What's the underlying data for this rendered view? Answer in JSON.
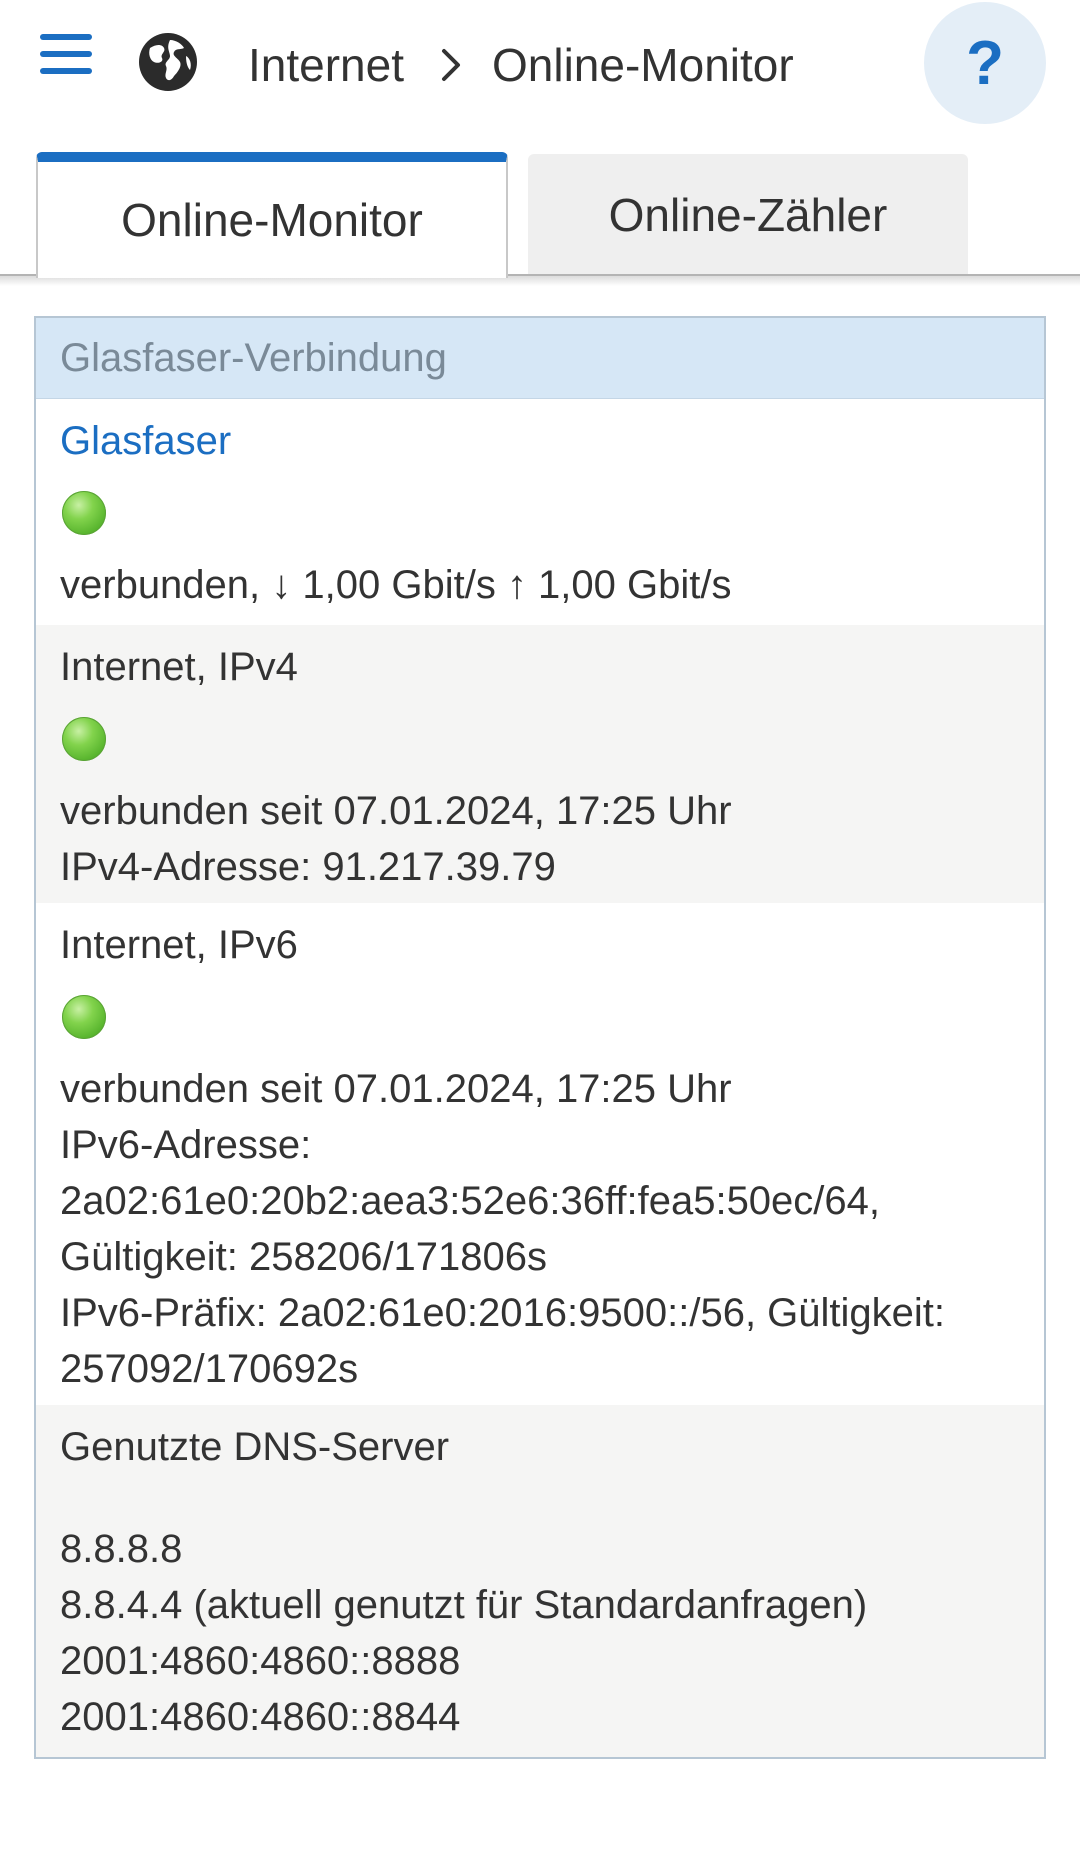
{
  "header": {
    "menu_icon": "hamburger-menu-icon",
    "globe_icon": "globe-icon",
    "breadcrumb": [
      "Internet",
      "Online-Monitor"
    ],
    "help_label": "?"
  },
  "tabs": [
    {
      "label": "Online-Monitor",
      "active": true
    },
    {
      "label": "Online-Zähler",
      "active": false
    }
  ],
  "colors": {
    "accent": "#1b6ec2",
    "panel_header_bg": "#d6e7f6",
    "row_gray": "#f5f5f4",
    "status_green": "#6cc43a"
  },
  "panel": {
    "title": "Glasfaser-Verbindung",
    "sections": [
      {
        "title": "Glasfaser",
        "status": "green",
        "lines": [
          "verbunden, ↓ 1,00 Gbit/s ↑ 1,00 Gbit/s"
        ]
      },
      {
        "title": "Internet, IPv4",
        "status": "green",
        "lines": [
          "verbunden seit 07.01.2024, 17:25 Uhr",
          "IPv4-Adresse: 91.217.39.79"
        ]
      },
      {
        "title": "Internet, IPv6",
        "status": "green",
        "lines": [
          "verbunden seit 07.01.2024, 17:25 Uhr",
          "IPv6-Adresse:",
          "2a02:61e0:20b2:aea3:52e6:36ff:fea5:50ec/64,",
          "Gültigkeit: 258206/171806s",
          "IPv6-Präfix: 2a02:61e0:2016:9500::/56, Gültigkeit:",
          "257092/170692s"
        ]
      },
      {
        "title": "Genutzte DNS-Server",
        "lines": [
          "8.8.8.8",
          "8.8.4.4 (aktuell genutzt für Standardanfragen)",
          "2001:4860:4860::8888",
          "2001:4860:4860::8844"
        ]
      }
    ]
  }
}
